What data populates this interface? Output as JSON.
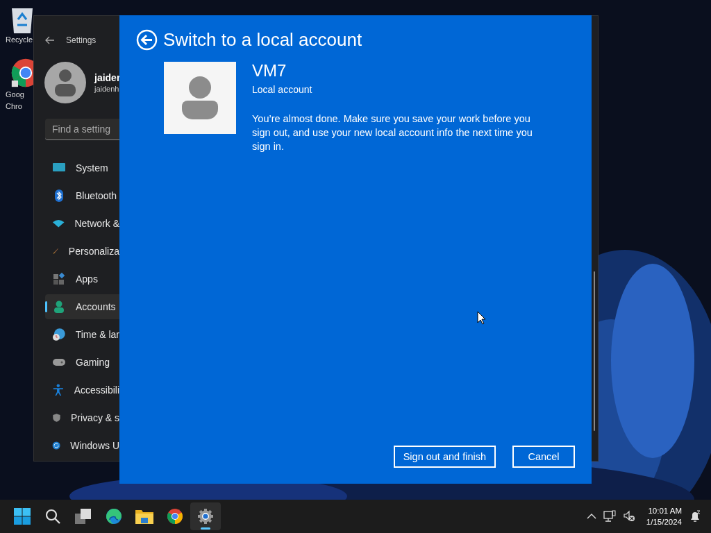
{
  "desktop": {
    "icons": [
      {
        "kind": "recycle",
        "lines": [
          "Recycle"
        ]
      },
      {
        "kind": "chrome",
        "lines": [
          "Goog",
          "Chro"
        ]
      }
    ]
  },
  "settings_window": {
    "title": "Settings",
    "user": {
      "name": "jaider",
      "email": "jaidenh"
    },
    "search": {
      "placeholder": "Find a setting"
    },
    "nav": [
      {
        "kind": "system",
        "label": "System",
        "selected": false
      },
      {
        "kind": "bluetooth",
        "label": "Bluetooth",
        "selected": false
      },
      {
        "kind": "network",
        "label": "Network &",
        "selected": false
      },
      {
        "kind": "personalization",
        "label": "Personaliza",
        "selected": false
      },
      {
        "kind": "apps",
        "label": "Apps",
        "selected": false
      },
      {
        "kind": "accounts",
        "label": "Accounts",
        "selected": true
      },
      {
        "kind": "time",
        "label": "Time & lar",
        "selected": false
      },
      {
        "kind": "gaming",
        "label": "Gaming",
        "selected": false
      },
      {
        "kind": "accessibility",
        "label": "Accessibili",
        "selected": false
      },
      {
        "kind": "privacy",
        "label": "Privacy & s",
        "selected": false
      },
      {
        "kind": "update",
        "label": "Windows U",
        "selected": false
      }
    ]
  },
  "dialog": {
    "title": "Switch to a local account",
    "account_name": "VM7",
    "account_type": "Local account",
    "message": "You’re almost done. Make sure you save your work before you sign out, and use your new local account info the next time you sign in.",
    "buttons": [
      "Sign out and finish",
      "Cancel"
    ]
  },
  "taskbar": {
    "apps": [
      {
        "kind": "start",
        "active": false
      },
      {
        "kind": "search",
        "active": false
      },
      {
        "kind": "taskview",
        "active": false
      },
      {
        "kind": "edge",
        "active": false
      },
      {
        "kind": "explorer",
        "active": false
      },
      {
        "kind": "chrome",
        "active": false
      },
      {
        "kind": "settings",
        "active": true
      }
    ],
    "time": "10:01 AM",
    "date": "1/15/2024"
  }
}
